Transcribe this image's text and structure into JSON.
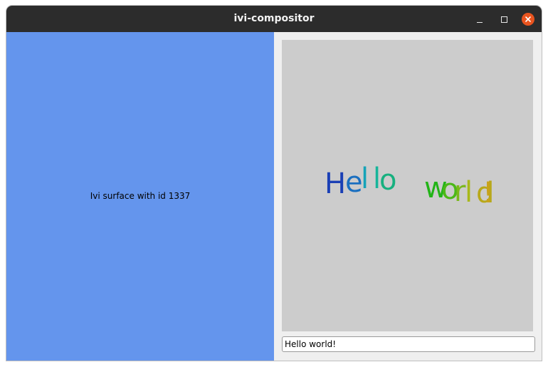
{
  "window": {
    "title": "ivi-compositor",
    "controls": [
      "minimize-icon",
      "maximize-icon",
      "close-icon"
    ],
    "close_color": "#e9541f",
    "titlebar_color": "#2c2c2c"
  },
  "ivi_surface": {
    "label": "Ivi surface with id 1337",
    "background": "#6495ed"
  },
  "hello_canvas": {
    "text": "Hello world!",
    "background": "#cccccc",
    "letter_colors": [
      "#1a3fb5",
      "#1a6fc0",
      "#14a3b8",
      "#16b59a",
      "#17b07f",
      "#1eb21e",
      "#22b417",
      "#4cb818",
      "#7ab81a",
      "#a8b81a",
      "#b8a81a",
      "#c8a21a"
    ]
  },
  "text_field": {
    "value": "Hello world!"
  }
}
